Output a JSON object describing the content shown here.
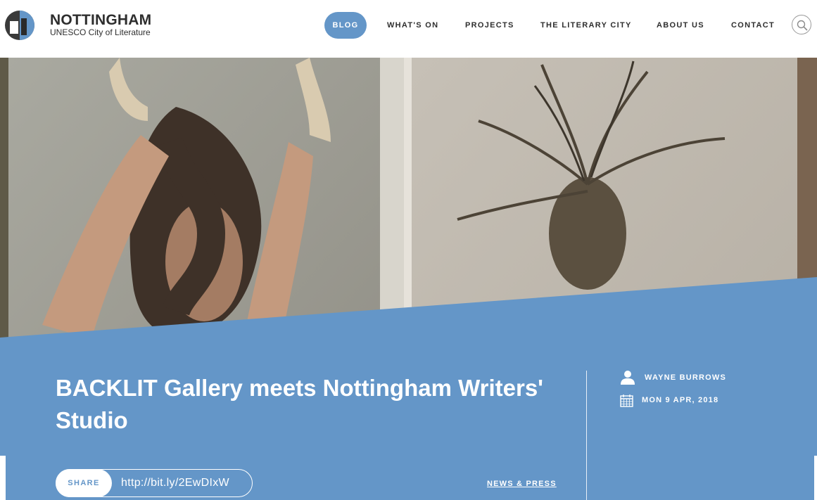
{
  "brand": {
    "title": "NOTTINGHAM",
    "subtitle": "UNESCO City of Literature"
  },
  "nav": {
    "items": [
      {
        "label": "BLOG",
        "active": true
      },
      {
        "label": "WHAT'S ON",
        "active": false
      },
      {
        "label": "PROJECTS",
        "active": false
      },
      {
        "label": "THE LITERARY CITY",
        "active": false
      },
      {
        "label": "ABOUT US",
        "active": false
      },
      {
        "label": "CONTACT",
        "active": false
      }
    ],
    "search_icon": "search-icon"
  },
  "post": {
    "title": "BACKLIT Gallery meets Nottingham Writers' Studio",
    "author": "WAYNE BURROWS",
    "date": "MON 9 APR, 2018",
    "share_label": "SHARE",
    "share_url": "http://bit.ly/2EwDIxW",
    "category": "NEWS & PRESS"
  },
  "colors": {
    "accent": "#6496c8",
    "text": "#2e2e2e",
    "white": "#ffffff"
  }
}
